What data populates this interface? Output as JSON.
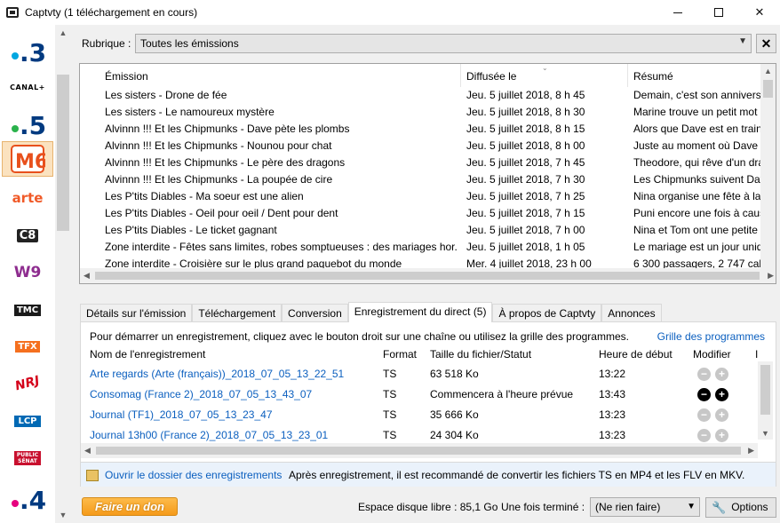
{
  "window": {
    "title": "Captvty (1 téléchargement en cours)",
    "controls": [
      "minimize-icon",
      "maximize-icon",
      "close-icon"
    ]
  },
  "channels": [
    {
      "name": "france-3",
      "text": ".3",
      "color": "#003a80",
      "accent": "#00a7e1"
    },
    {
      "name": "canal-plus",
      "text": "CANAL+",
      "color": "#000000"
    },
    {
      "name": "france-5",
      "text": ".5",
      "color": "#003a80",
      "accent": "#2bb24c"
    },
    {
      "name": "m6",
      "text": "M6",
      "color": "#e8501c",
      "selected": true
    },
    {
      "name": "arte",
      "text": "arte",
      "color": "#f05a28"
    },
    {
      "name": "c8",
      "text": "C8",
      "color": "#222222"
    },
    {
      "name": "w9",
      "text": "W9",
      "color": "#8e2d8f"
    },
    {
      "name": "tmc",
      "text": "TMC",
      "color": "#1a1a1a"
    },
    {
      "name": "tfx",
      "text": "TFX",
      "color": "#f5701f"
    },
    {
      "name": "nrj12",
      "text": "NRJ",
      "color": "#d4001a"
    },
    {
      "name": "lcp",
      "text": "LCP",
      "color": "#0069b4"
    },
    {
      "name": "public-senat",
      "text": "PUBLIC SÉNAT",
      "color": "#c8102e"
    },
    {
      "name": "france-4",
      "text": ".4",
      "color": "#003a80",
      "accent": "#e6007e"
    }
  ],
  "rubrique": {
    "label": "Rubrique :",
    "value": "Toutes les émissions",
    "close": "✕"
  },
  "emissions": {
    "headers": [
      "Émission",
      "Diffusée le",
      "Résumé"
    ],
    "rows": [
      [
        "Les sisters - Drone de fée",
        "Jeu. 5 juillet 2018, 8 h 45",
        "Demain, c'est son anniversa"
      ],
      [
        "Les sisters - Le namoureux mystère",
        "Jeu. 5 juillet 2018, 8 h 30",
        "Marine trouve un petit mot"
      ],
      [
        "Alvinnn !!! Et les Chipmunks - Dave pète les plombs",
        "Jeu. 5 juillet 2018, 8 h 15",
        "Alors que Dave est en train"
      ],
      [
        "Alvinnn !!! Et les Chipmunks - Nounou pour chat",
        "Jeu. 5 juillet 2018, 8 h 00",
        "Juste au moment où Dave e"
      ],
      [
        "Alvinnn !!! Et les Chipmunks - Le père des dragons",
        "Jeu. 5 juillet 2018, 7 h 45",
        "Theodore, qui rêve d'un dra"
      ],
      [
        "Alvinnn !!! Et les Chipmunks - La poupée de cire",
        "Jeu. 5 juillet 2018, 7 h 30",
        "Les Chipmunks suivent Dav"
      ],
      [
        "Les P'tits Diables - Ma soeur est une alien",
        "Jeu. 5 juillet 2018, 7 h 25",
        "Nina organise une fête à la"
      ],
      [
        "Les P'tits Diables - Oeil pour oeil / Dent pour dent",
        "Jeu. 5 juillet 2018, 7 h 15",
        "Puni encore une fois à caus"
      ],
      [
        "Les P'tits Diables - Le ticket gagnant",
        "Jeu. 5 juillet 2018, 7 h 00",
        "Nina et Tom ont une petite"
      ],
      [
        "Zone interdite - Fêtes sans limites, robes somptueuses : des mariages hor...",
        "Jeu. 5 juillet 2018, 1 h 05",
        "Le mariage est un jour uniq"
      ],
      [
        "Zone interdite - Croisière sur le plus grand paquebot du monde",
        "Mer. 4 juillet 2018, 23 h 00",
        "6 300 passagers, 2 747 cabir"
      ]
    ]
  },
  "tabs": [
    {
      "label": "Détails sur l'émission",
      "active": false
    },
    {
      "label": "Téléchargement",
      "active": false
    },
    {
      "label": "Conversion",
      "active": false
    },
    {
      "label": "Enregistrement du direct (5)",
      "active": true
    },
    {
      "label": "À propos de Captvty",
      "active": false
    },
    {
      "label": "Annonces",
      "active": false
    }
  ],
  "recording": {
    "instructions": "Pour démarrer un enregistrement, cliquez avec le bouton droit sur une chaîne ou utilisez la grille des programmes.",
    "grid_link": "Grille des programmes",
    "headers": [
      "Nom de l'enregistrement",
      "Format",
      "Taille du fichier/Statut",
      "Heure de début",
      "Modifier",
      "I"
    ],
    "rows": [
      {
        "name": "Arte regards (Arte (français))_2018_07_05_13_22_51",
        "format": "TS",
        "status": "63 518 Ko",
        "start": "13:22",
        "enabled": false
      },
      {
        "name": "Consomag (France 2)_2018_07_05_13_43_07",
        "format": "TS",
        "status": "Commencera à l'heure prévue",
        "start": "13:43",
        "enabled": true
      },
      {
        "name": "Journal (TF1)_2018_07_05_13_23_47",
        "format": "TS",
        "status": "35 666 Ko",
        "start": "13:23",
        "enabled": false
      },
      {
        "name": "Journal 13h00 (France 2)_2018_07_05_13_23_01",
        "format": "TS",
        "status": "24 304 Ko",
        "start": "13:23",
        "enabled": false
      }
    ],
    "minus": "−",
    "plus": "+",
    "folder_link": "Ouvrir le dossier des enregistrements",
    "folder_note": "Après enregistrement, il est recommandé de convertir les fichiers TS en MP4 et les FLV en MKV."
  },
  "footer": {
    "donate": "Faire un don",
    "disk_space": "Espace disque libre : 85,1 Go",
    "once_done_label": "Une fois terminé :",
    "once_done_value": "(Ne rien faire)",
    "options": "Options"
  },
  "colors": {
    "link": "#0b5fbf",
    "selected_channel_bg": "#fbe2bf",
    "donate_button": "#f59a1a"
  }
}
